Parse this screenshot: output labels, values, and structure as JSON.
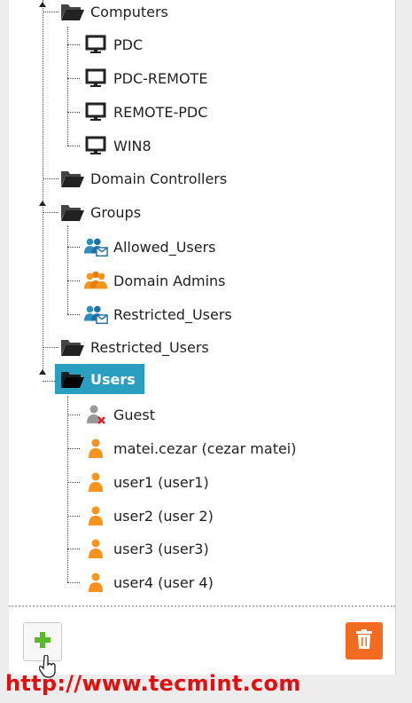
{
  "tree": {
    "computers": {
      "label": "Computers",
      "children": [
        "PDC",
        "PDC-REMOTE",
        "REMOTE-PDC",
        "WIN8"
      ]
    },
    "domain_controllers": {
      "label": "Domain Controllers"
    },
    "groups": {
      "label": "Groups",
      "children": [
        "Allowed_Users",
        "Domain Admins",
        "Restricted_Users"
      ]
    },
    "restricted_users": {
      "label": "Restricted_Users"
    },
    "users": {
      "label": "Users",
      "children": [
        "Guest",
        "matei.cezar (cezar matei)",
        "user1 (user1)",
        "user2 (user 2)",
        "user3 (user3)",
        "user4 (user 4)"
      ]
    }
  },
  "watermark": "http://www.tecmint.com",
  "colors": {
    "selected": "#2a9fbf",
    "user_icon": "#f7941d",
    "delete_button": "#f26b21",
    "add_icon": "#5cb82b",
    "watermark": "#e01010"
  },
  "icons": {
    "folder": "folder-open-icon",
    "computer": "computer-icon",
    "group": "group-icon",
    "user": "user-icon",
    "disabled_user": "disabled-user-icon",
    "add": "plus-icon",
    "delete": "trash-icon"
  }
}
